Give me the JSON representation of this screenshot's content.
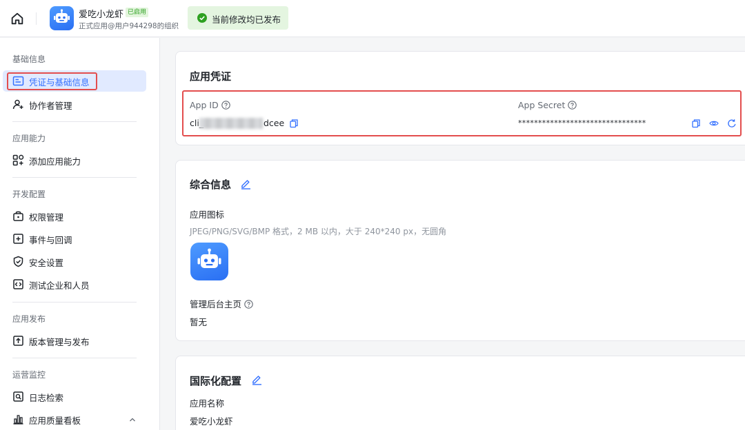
{
  "header": {
    "app_name": "爱吃小龙虾",
    "app_status": "已启用",
    "app_org": "正式应用@用户944298的组织",
    "toast_text": "当前修改均已发布"
  },
  "sidebar": {
    "sections": [
      {
        "title": "基础信息",
        "items": [
          {
            "label": "凭证与基础信息",
            "icon": "id-card-icon"
          },
          {
            "label": "协作者管理",
            "icon": "user-plus-icon"
          }
        ]
      },
      {
        "title": "应用能力",
        "items": [
          {
            "label": "添加应用能力",
            "icon": "grid-add-icon"
          }
        ]
      },
      {
        "title": "开发配置",
        "items": [
          {
            "label": "权限管理",
            "icon": "lock-box-icon"
          },
          {
            "label": "事件与回调",
            "icon": "event-plus-icon"
          },
          {
            "label": "安全设置",
            "icon": "shield-check-icon"
          },
          {
            "label": "测试企业和人员",
            "icon": "code-box-icon"
          }
        ]
      },
      {
        "title": "应用发布",
        "items": [
          {
            "label": "版本管理与发布",
            "icon": "upload-box-icon"
          }
        ]
      },
      {
        "title": "运营监控",
        "items": [
          {
            "label": "日志检索",
            "icon": "log-search-icon"
          },
          {
            "label": "应用质量看板",
            "icon": "bar-chart-icon"
          }
        ]
      }
    ]
  },
  "credentials": {
    "title": "应用凭证",
    "app_id_label": "App ID",
    "app_id_prefix": "cli_",
    "app_id_suffix": "dcee",
    "app_secret_label": "App Secret",
    "app_secret_value": "********************************"
  },
  "general": {
    "title": "综合信息",
    "icon_label": "应用图标",
    "icon_hint": "JPEG/PNG/SVG/BMP 格式，2 MB 以内，大于 240*240 px，无圆角",
    "homepage_label": "管理后台主页",
    "homepage_value": "暂无"
  },
  "i18n": {
    "title": "国际化配置",
    "name_label": "应用名称",
    "name_value": "爱吃小龙虾"
  },
  "colors": {
    "accent": "#3370ff",
    "highlight": "#e34d4d",
    "success": "#2ea121"
  }
}
